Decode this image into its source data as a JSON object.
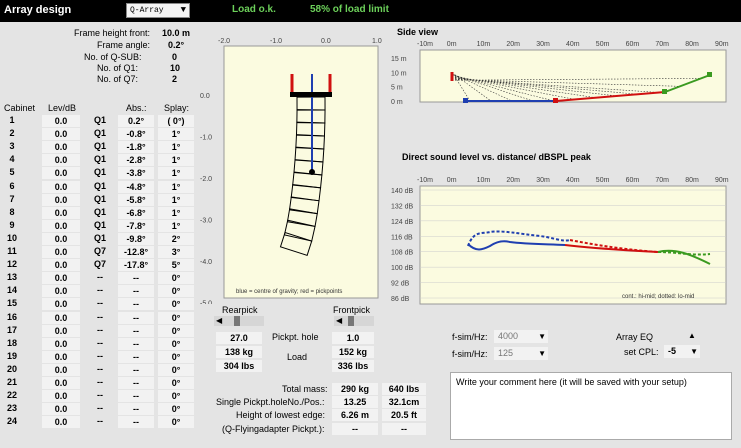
{
  "header": {
    "title": "Array design",
    "preset": "Q-Array",
    "status_load": "Load o.k.",
    "status_limit": "58% of load limit"
  },
  "frame": {
    "height_front_label": "Frame height front:",
    "height_front_value": "10.0 m",
    "angle_label": "Frame angle:",
    "angle_value": "0.2°",
    "nsub_label": "No. of Q-SUB:",
    "nsub_value": "0",
    "nq1_label": "No. of Q1:",
    "nq1_value": "10",
    "nq7_label": "No. of Q7:",
    "nq7_value": "2"
  },
  "table": {
    "headers": {
      "cabinet": "Cabinet",
      "lev": "Lev/dB",
      "abs": "Abs.:",
      "splay": "Splay:"
    },
    "rows": [
      {
        "n": "1",
        "lev": "0.0",
        "type": "Q1",
        "abs": "0.2°",
        "splay": "( 0°)"
      },
      {
        "n": "2",
        "lev": "0.0",
        "type": "Q1",
        "abs": "-0.8°",
        "splay": "1°"
      },
      {
        "n": "3",
        "lev": "0.0",
        "type": "Q1",
        "abs": "-1.8°",
        "splay": "1°"
      },
      {
        "n": "4",
        "lev": "0.0",
        "type": "Q1",
        "abs": "-2.8°",
        "splay": "1°"
      },
      {
        "n": "5",
        "lev": "0.0",
        "type": "Q1",
        "abs": "-3.8°",
        "splay": "1°"
      },
      {
        "n": "6",
        "lev": "0.0",
        "type": "Q1",
        "abs": "-4.8°",
        "splay": "1°"
      },
      {
        "n": "7",
        "lev": "0.0",
        "type": "Q1",
        "abs": "-5.8°",
        "splay": "1°"
      },
      {
        "n": "8",
        "lev": "0.0",
        "type": "Q1",
        "abs": "-6.8°",
        "splay": "1°"
      },
      {
        "n": "9",
        "lev": "0.0",
        "type": "Q1",
        "abs": "-7.8°",
        "splay": "1°"
      },
      {
        "n": "10",
        "lev": "0.0",
        "type": "Q1",
        "abs": "-9.8°",
        "splay": "2°"
      },
      {
        "n": "11",
        "lev": "0.0",
        "type": "Q7",
        "abs": "-12.8°",
        "splay": "3°"
      },
      {
        "n": "12",
        "lev": "0.0",
        "type": "Q7",
        "abs": "-17.8°",
        "splay": "5°"
      },
      {
        "n": "13",
        "lev": "0.0",
        "type": "--",
        "abs": "--",
        "splay": "0°"
      },
      {
        "n": "14",
        "lev": "0.0",
        "type": "--",
        "abs": "--",
        "splay": "0°"
      },
      {
        "n": "15",
        "lev": "0.0",
        "type": "--",
        "abs": "--",
        "splay": "0°"
      },
      {
        "n": "16",
        "lev": "0.0",
        "type": "--",
        "abs": "--",
        "splay": "0°"
      },
      {
        "n": "17",
        "lev": "0.0",
        "type": "--",
        "abs": "--",
        "splay": "0°"
      },
      {
        "n": "18",
        "lev": "0.0",
        "type": "--",
        "abs": "--",
        "splay": "0°"
      },
      {
        "n": "19",
        "lev": "0.0",
        "type": "--",
        "abs": "--",
        "splay": "0°"
      },
      {
        "n": "20",
        "lev": "0.0",
        "type": "--",
        "abs": "--",
        "splay": "0°"
      },
      {
        "n": "21",
        "lev": "0.0",
        "type": "--",
        "abs": "--",
        "splay": "0°"
      },
      {
        "n": "22",
        "lev": "0.0",
        "type": "--",
        "abs": "--",
        "splay": "0°"
      },
      {
        "n": "23",
        "lev": "0.0",
        "type": "--",
        "abs": "--",
        "splay": "0°"
      },
      {
        "n": "24",
        "lev": "0.0",
        "type": "--",
        "abs": "--",
        "splay": "0°"
      }
    ]
  },
  "array_plot": {
    "x_ticks": [
      "-2.0",
      "-1.0",
      "0.0",
      "1.0"
    ],
    "y_ticks": [
      "0.0",
      "-1.0",
      "-2.0",
      "-3.0",
      "-4.0",
      "-5.0"
    ],
    "legend": "blue = centre of gravity; red = pickpoints"
  },
  "pick": {
    "rear_label": "Rearpick",
    "front_label": "Frontpick",
    "rear_hole": "27.0",
    "front_hole": "1.0",
    "hole_label": "Pickpt. hole",
    "rear_kg": "138 kg",
    "front_kg": "152 kg",
    "load_label": "Load",
    "rear_lbs": "304 lbs",
    "front_lbs": "336 lbs"
  },
  "totals": {
    "mass_label": "Total mass:",
    "mass_kg": "290 kg",
    "mass_lbs": "640 lbs",
    "single_label": "Single Pickpt.holeNo./Pos.:",
    "single_no": "13.25",
    "single_pos": "32.1cm",
    "lowest_label": "Height of lowest edge:",
    "lowest_m": "6.26 m",
    "lowest_ft": "20.5 ft",
    "fly_label": "(Q-Flyingadapter Pickpt.):",
    "fly_1": "--",
    "fly_2": "--"
  },
  "side_view": {
    "title": "Side view",
    "x_ticks": [
      "-10m",
      "0m",
      "10m",
      "20m",
      "30m",
      "40m",
      "50m",
      "60m",
      "70m",
      "80m",
      "90m"
    ],
    "y_ticks": [
      "15 m",
      "10 m",
      "5 m",
      "0 m"
    ]
  },
  "spl": {
    "title": "Direct sound level vs. distance/ dBSPL peak",
    "x_ticks": [
      "-10m",
      "0m",
      "10m",
      "20m",
      "30m",
      "40m",
      "50m",
      "60m",
      "70m",
      "80m",
      "90m"
    ],
    "y_ticks": [
      "140 dB",
      "132 dB",
      "124 dB",
      "116 dB",
      "108 dB",
      "100 dB",
      "92 dB",
      "86 dB"
    ],
    "legend": "cont.: hi-mid; dotted: lo-mid"
  },
  "controls": {
    "fsim1_label": "f-sim/Hz:",
    "fsim1_value": "4000",
    "fsim2_label": "f-sim/Hz:",
    "fsim2_value": "125",
    "eq_label": "Array EQ",
    "cpl_label": "set CPL:",
    "cpl_value": "-5"
  },
  "comment": {
    "placeholder": "Write your comment here (it will be saved with your setup)"
  },
  "colors": {
    "status": "#6cd05a",
    "plot_bg": "#fbfbe0",
    "blue": "#1f3fb0",
    "red": "#d01010",
    "green": "#3a9a20"
  }
}
